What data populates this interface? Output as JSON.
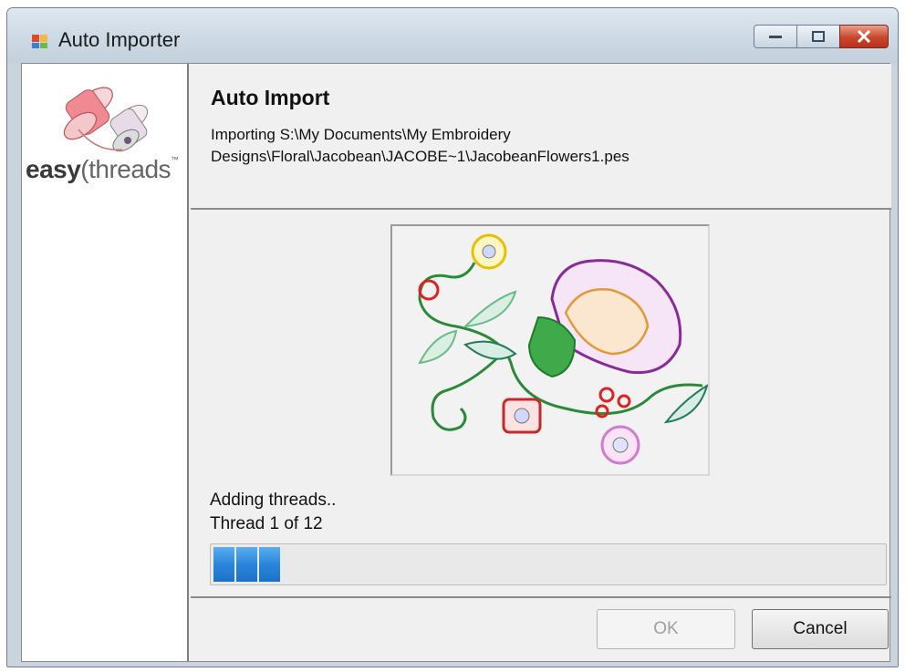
{
  "window": {
    "title": "Auto Importer",
    "controls": [
      "minimize",
      "maximize",
      "close"
    ]
  },
  "logo": {
    "easy": "easy",
    "threads": "threads",
    "tm": "™"
  },
  "header": {
    "title": "Auto Import",
    "path": "Importing S:\\My Documents\\My Embroidery Designs\\Floral\\Jacobean\\JACOBE~1\\JacobeanFlowers1.pes"
  },
  "status": {
    "line1": "Adding threads..",
    "line2": "Thread 1 of 12"
  },
  "progress": {
    "fraction": 0.09,
    "segments": 3
  },
  "buttons": {
    "ok": "OK",
    "cancel": "Cancel"
  },
  "colors": {
    "progress": "#2a86db",
    "close_button": "#c9462c"
  }
}
